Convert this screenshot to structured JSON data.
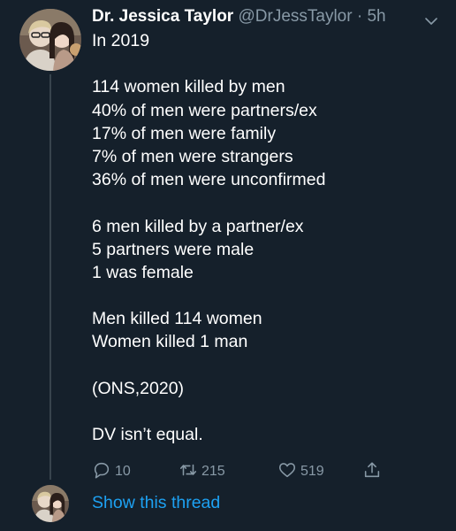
{
  "tweet": {
    "author_name": "Dr. Jessica Taylor",
    "author_handle": "@DrJessTaylor",
    "separator": "·",
    "time": "5h",
    "lines": [
      "In 2019",
      "",
      "114 women killed by men",
      "40% of men were partners/ex",
      "17% of men were family",
      "7% of men were strangers",
      "36% of men were unconfirmed",
      "",
      "6 men killed by a partner/ex",
      "5 partners were male",
      "1 was female",
      "",
      "Men killed 114 women",
      "Women killed 1 man",
      "",
      "(ONS,2020)",
      "",
      "DV isn’t equal."
    ],
    "reply_count": "10",
    "retweet_count": "215",
    "like_count": "519"
  },
  "thread": {
    "show_label": "Show this thread"
  },
  "icons": {
    "reply": "reply-icon",
    "retweet": "retweet-icon",
    "like": "heart-icon",
    "share": "share-icon",
    "more": "chevron-down-icon"
  },
  "colors": {
    "background": "#15202b",
    "text": "#ffffff",
    "secondary": "#8899a6",
    "link": "#1da1f2",
    "thread_line": "#38444d"
  }
}
